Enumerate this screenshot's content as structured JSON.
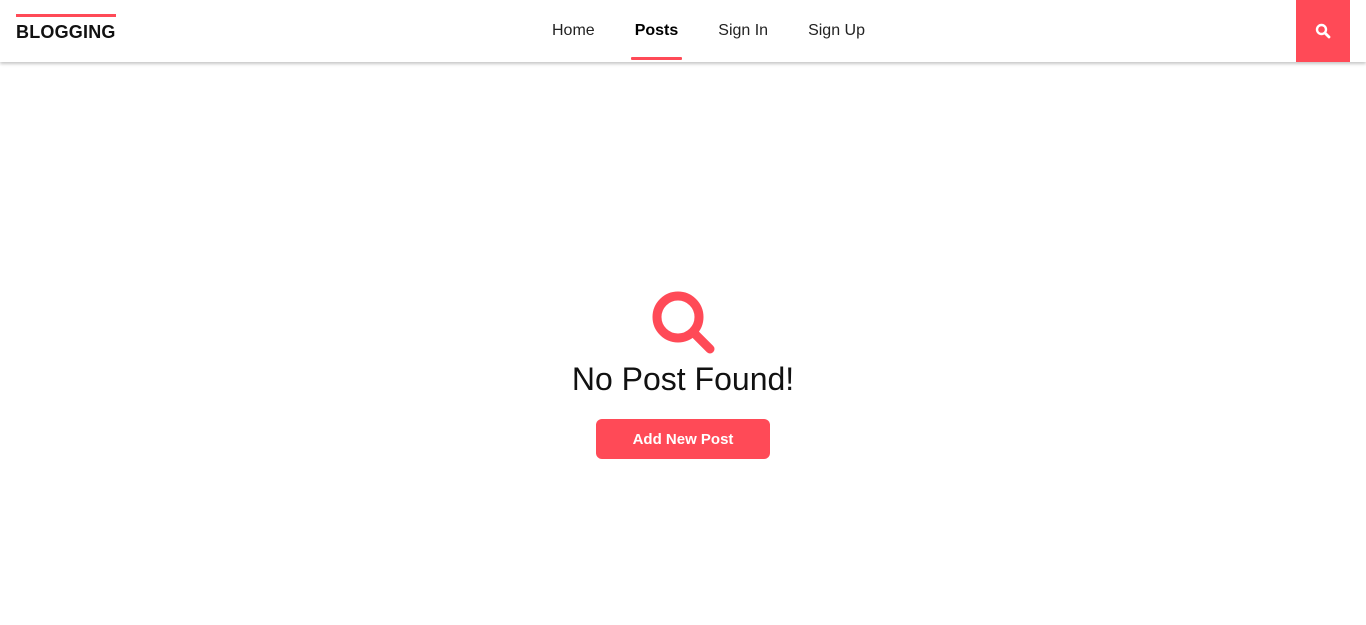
{
  "header": {
    "logo": "BLOGGING",
    "nav": [
      {
        "label": "Home",
        "active": false
      },
      {
        "label": "Posts",
        "active": true
      },
      {
        "label": "Sign In",
        "active": false
      },
      {
        "label": "Sign Up",
        "active": false
      }
    ],
    "search_icon": "search-icon"
  },
  "main": {
    "empty_icon": "search-icon",
    "message": "No Post Found!",
    "add_button_label": "Add New Post"
  },
  "colors": {
    "accent": "#ff4a57",
    "text": "#111111",
    "background": "#ffffff"
  }
}
